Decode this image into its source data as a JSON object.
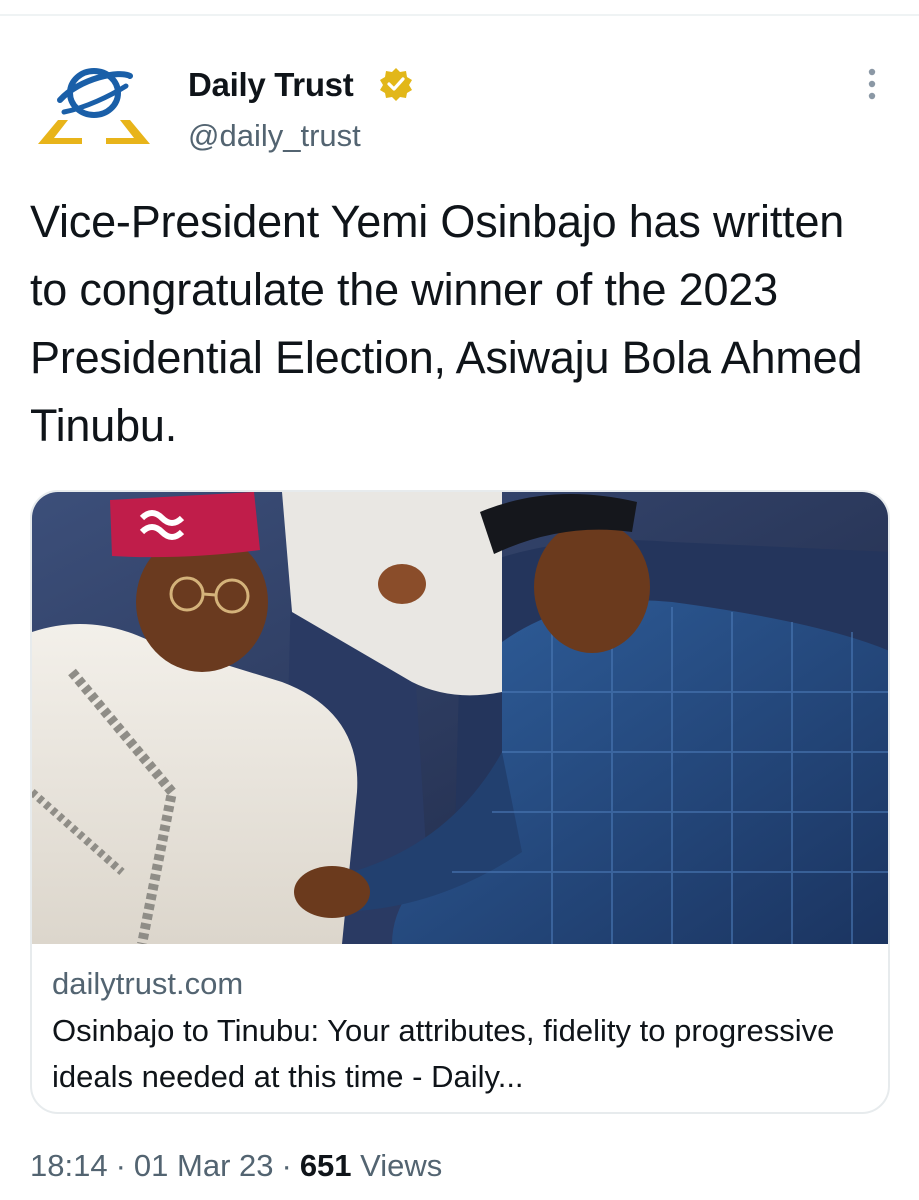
{
  "author": {
    "name": "Daily Trust",
    "handle": "@daily_trust",
    "verified": true,
    "badge_color": "#e2b719",
    "avatar_icon": "daily-trust-logo"
  },
  "tweet": {
    "text": "Vice-President Yemi Osinbajo has written to congratulate the winner of the 2023 Presidential Election, Asiwaju Bola Ahmed Tinubu."
  },
  "card": {
    "image": "photo-of-tinubu-and-osinbajo",
    "domain": "dailytrust.com",
    "title": "Osinbajo to Tinubu: Your attributes, fidelity to progressive ideals needed at this time - Daily..."
  },
  "meta": {
    "time": "18:14",
    "date": "01 Mar 23",
    "views_count": "651",
    "views_label": "Views"
  },
  "colors": {
    "text_primary": "#0f1419",
    "text_secondary": "#536471",
    "logo_blue": "#1a5fa8",
    "logo_gold": "#e8b41a"
  }
}
